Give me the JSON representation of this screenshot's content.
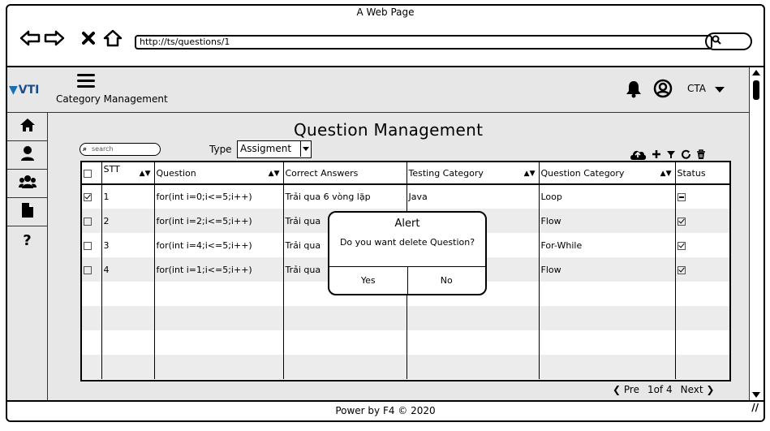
{
  "window": {
    "title": "A Web Page"
  },
  "browser": {
    "url": "http://ts/questions/1",
    "back_icon": "arrow-left-icon",
    "forward_icon": "arrow-right-icon",
    "close_icon": "x-icon",
    "home_icon": "home-icon",
    "search_icon": "search-icon"
  },
  "app": {
    "logo": "VTI",
    "breadcrumb": "Category Management",
    "user_name": "CTA",
    "icons": {
      "menu": "hamburger-icon",
      "bell": "bell-icon",
      "user": "user-icon"
    }
  },
  "sidebar": {
    "items": [
      {
        "name": "home",
        "icon": "home-icon"
      },
      {
        "name": "user",
        "icon": "user-icon"
      },
      {
        "name": "group",
        "icon": "group-icon"
      },
      {
        "name": "document",
        "icon": "document-icon"
      },
      {
        "name": "help",
        "icon": "question-icon",
        "label": "?"
      }
    ]
  },
  "main": {
    "heading": "Question Management",
    "search_placeholder": "search",
    "type_label": "Type",
    "type_value": "Assigment",
    "toolbar": [
      "cloud-icon",
      "plus-icon",
      "filter-icon",
      "refresh-icon",
      "trash-icon"
    ],
    "table": {
      "headers": [
        "",
        "STT",
        "Question",
        "Correct Answers",
        "Testing Category",
        "Question Category",
        "Status"
      ],
      "rows": [
        {
          "checked": true,
          "stt": "1",
          "question": "for(int i=0;i<=5;i++)",
          "answer": "Trải qua 6 vòng lặp",
          "testing": "Java",
          "category": "Loop",
          "status": "partial"
        },
        {
          "checked": false,
          "stt": "2",
          "question": "for(int i=2;i<=5;i++)",
          "answer": "Trải qua",
          "testing": "",
          "category": "Flow",
          "status": "checked"
        },
        {
          "checked": false,
          "stt": "3",
          "question": "for(int i=4;i<=5;i++)",
          "answer": "Trải qua",
          "testing": "",
          "category": "For-While",
          "status": "checked"
        },
        {
          "checked": false,
          "stt": "4",
          "question": "for(int i=1;i<=5;i++)",
          "answer": "Trải qua",
          "testing": "",
          "category": "Flow",
          "status": "checked"
        },
        {
          "checked": null,
          "stt": "",
          "question": "",
          "answer": "",
          "testing": "",
          "category": "",
          "status": ""
        },
        {
          "checked": null,
          "stt": "",
          "question": "",
          "answer": "",
          "testing": "",
          "category": "",
          "status": ""
        },
        {
          "checked": null,
          "stt": "",
          "question": "",
          "answer": "",
          "testing": "",
          "category": "",
          "status": ""
        },
        {
          "checked": null,
          "stt": "",
          "question": "",
          "answer": "",
          "testing": "",
          "category": "",
          "status": ""
        }
      ]
    },
    "pager": {
      "prev": "Pre",
      "info": "1of 4",
      "next": "Next"
    }
  },
  "alert": {
    "title": "Alert",
    "message": "Do you want delete Question?",
    "yes": "Yes",
    "no": "No"
  },
  "footer": {
    "text": "Power by F4 © 2020"
  }
}
